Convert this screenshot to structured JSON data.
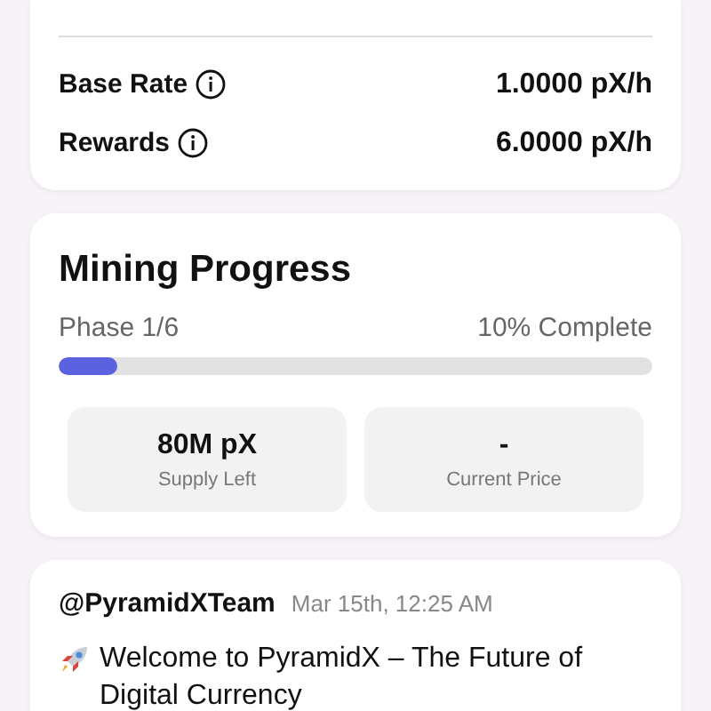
{
  "stats": [
    {
      "label": "Base Rate",
      "value": "1.0000 pX/h"
    },
    {
      "label": "Rewards",
      "value": "6.0000 pX/h"
    }
  ],
  "progress": {
    "title": "Mining Progress",
    "phase": "Phase 1/6",
    "complete": "10% Complete",
    "level": 0.1,
    "tiles": [
      {
        "value": "80M pX",
        "label": "Supply Left"
      },
      {
        "value": "-",
        "label": "Current Price"
      }
    ]
  },
  "post": {
    "author": "@PyramidXTeam",
    "time": "Mar 15th, 12:25 AM",
    "text": "Welcome to PyramidX – The Future of Digital Currency"
  }
}
